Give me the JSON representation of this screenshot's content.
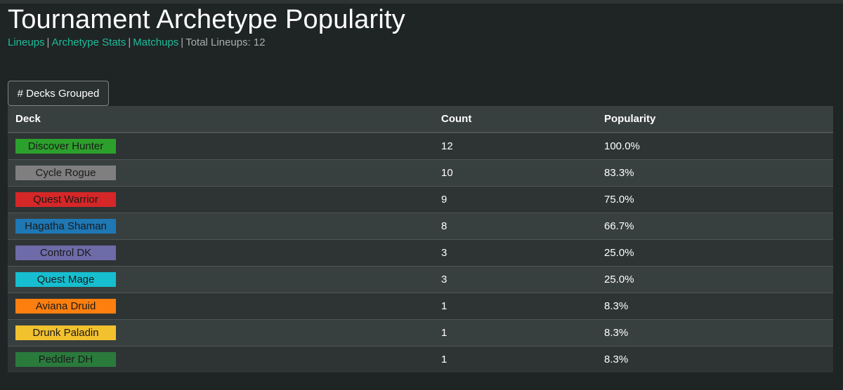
{
  "page": {
    "title": "Tournament Archetype Popularity"
  },
  "nav": {
    "links": [
      {
        "label": "Lineups"
      },
      {
        "label": "Archetype Stats"
      },
      {
        "label": "Matchups"
      }
    ],
    "separator": "|",
    "total_label": "Total Lineups: 12"
  },
  "toolbar": {
    "group_button_label": "# Decks Grouped"
  },
  "table": {
    "headers": {
      "deck": "Deck",
      "count": "Count",
      "popularity": "Popularity"
    },
    "rows": [
      {
        "deck": "Discover Hunter",
        "count": "12",
        "popularity": "100.0%",
        "chip_color": "#2ca02c",
        "chip_text_color": "#1a1a1a"
      },
      {
        "deck": "Cycle Rogue",
        "count": "10",
        "popularity": "83.3%",
        "chip_color": "#7f7f7f",
        "chip_text_color": "#1a1a1a"
      },
      {
        "deck": "Quest Warrior",
        "count": "9",
        "popularity": "75.0%",
        "chip_color": "#d62728",
        "chip_text_color": "#1a1a1a"
      },
      {
        "deck": "Hagatha Shaman",
        "count": "8",
        "popularity": "66.7%",
        "chip_color": "#1f77b4",
        "chip_text_color": "#1a1a1a"
      },
      {
        "deck": "Control DK",
        "count": "3",
        "popularity": "25.0%",
        "chip_color": "#6d6ba8",
        "chip_text_color": "#1a1a1a"
      },
      {
        "deck": "Quest Mage",
        "count": "3",
        "popularity": "25.0%",
        "chip_color": "#17becf",
        "chip_text_color": "#1a1a1a"
      },
      {
        "deck": "Aviana Druid",
        "count": "1",
        "popularity": "8.3%",
        "chip_color": "#ff7f0e",
        "chip_text_color": "#1a1a1a"
      },
      {
        "deck": "Drunk Paladin",
        "count": "1",
        "popularity": "8.3%",
        "chip_color": "#f2c12e",
        "chip_text_color": "#1a1a1a"
      },
      {
        "deck": "Peddler DH",
        "count": "1",
        "popularity": "8.3%",
        "chip_color": "#2a7a3c",
        "chip_text_color": "#1a1a1a"
      }
    ]
  }
}
